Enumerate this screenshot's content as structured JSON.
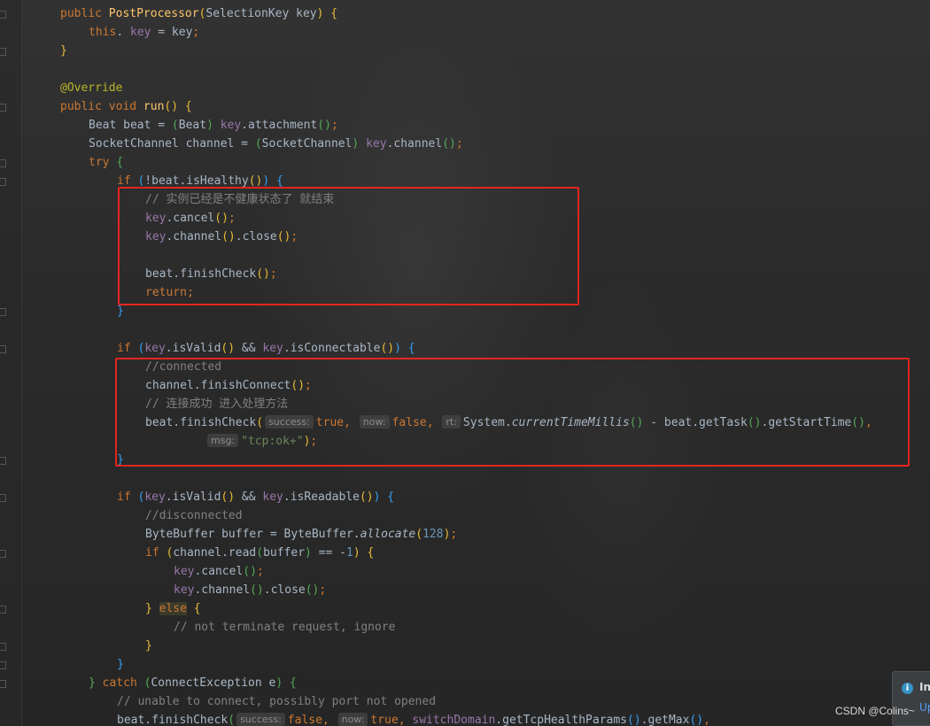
{
  "editor": {
    "lines": [
      [
        [
          "kw",
          "public "
        ],
        [
          "fn",
          "PostProcessor"
        ],
        [
          "b1",
          "("
        ],
        [
          "",
          "SelectionKey key"
        ],
        [
          "b1",
          ")"
        ],
        [
          "",
          " "
        ],
        [
          "b1",
          "{"
        ]
      ],
      [
        [
          "kw",
          "this"
        ],
        [
          "",
          ". "
        ],
        [
          "fld",
          "key"
        ],
        [
          "",
          " = key"
        ],
        [
          "kw",
          ";"
        ]
      ],
      [
        [
          "b1",
          "}"
        ]
      ],
      [],
      [
        [
          "an",
          "@Override"
        ]
      ],
      [
        [
          "kw",
          "public void "
        ],
        [
          "fn",
          "run"
        ],
        [
          "b1",
          "()"
        ],
        [
          "",
          " "
        ],
        [
          "b1",
          "{"
        ]
      ],
      [
        [
          "",
          "Beat beat = "
        ],
        [
          "b2",
          "("
        ],
        [
          "",
          "Beat"
        ],
        [
          "b2",
          ")"
        ],
        [
          "",
          " "
        ],
        [
          "fld",
          "key"
        ],
        [
          "",
          ".attachment"
        ],
        [
          "b2",
          "()"
        ],
        [
          "kw",
          ";"
        ]
      ],
      [
        [
          "",
          "SocketChannel channel = "
        ],
        [
          "b2",
          "("
        ],
        [
          "",
          "SocketChannel"
        ],
        [
          "b2",
          ")"
        ],
        [
          "",
          " "
        ],
        [
          "fld",
          "key"
        ],
        [
          "",
          ".channel"
        ],
        [
          "b2",
          "()"
        ],
        [
          "kw",
          ";"
        ]
      ],
      [
        [
          "kw",
          "try "
        ],
        [
          "b2",
          "{"
        ]
      ],
      [
        [
          "kw",
          "if "
        ],
        [
          "b3",
          "("
        ],
        [
          "",
          "!beat.isHealthy"
        ],
        [
          "b1",
          "()"
        ],
        [
          "b3",
          ")"
        ],
        [
          "",
          " "
        ],
        [
          "b3",
          "{"
        ]
      ],
      [
        [
          "cm",
          "// 实例已经是不健康状态了 就结束"
        ]
      ],
      [
        [
          "fld",
          "key"
        ],
        [
          "",
          ".cancel"
        ],
        [
          "b1",
          "()"
        ],
        [
          "kw",
          ";"
        ]
      ],
      [
        [
          "fld",
          "key"
        ],
        [
          "",
          ".channel"
        ],
        [
          "b1",
          "()"
        ],
        [
          "",
          ".close"
        ],
        [
          "b1",
          "()"
        ],
        [
          "kw",
          ";"
        ]
      ],
      [],
      [
        [
          "",
          "beat.finishCheck"
        ],
        [
          "b1",
          "()"
        ],
        [
          "kw",
          ";"
        ]
      ],
      [
        [
          "kw",
          "return;"
        ]
      ],
      [
        [
          "b3",
          "}"
        ]
      ],
      [],
      [
        [
          "kw",
          "if "
        ],
        [
          "b3",
          "("
        ],
        [
          "fld",
          "key"
        ],
        [
          "",
          ".isValid"
        ],
        [
          "b1",
          "()"
        ],
        [
          "",
          " && "
        ],
        [
          "fld",
          "key"
        ],
        [
          "",
          ".isConnectable"
        ],
        [
          "b1",
          "()"
        ],
        [
          "b3",
          ")"
        ],
        [
          "",
          " "
        ],
        [
          "b3",
          "{"
        ]
      ],
      [
        [
          "cm",
          "//connected"
        ]
      ],
      [
        [
          "",
          "channel.finishConnect"
        ],
        [
          "b1",
          "()"
        ],
        [
          "kw",
          ";"
        ]
      ],
      [
        [
          "cm",
          "// 连接成功 进入处理方法"
        ]
      ],
      [
        [
          "",
          "beat.finishCheck"
        ],
        [
          "b1",
          "("
        ],
        [
          "hint",
          "success:"
        ],
        [
          "kw",
          "true, "
        ],
        [
          "hint",
          "now:"
        ],
        [
          "kw",
          "false, "
        ],
        [
          "hint",
          "rt:"
        ],
        [
          "",
          "System."
        ],
        [
          "it",
          "currentTimeMillis"
        ],
        [
          "b2",
          "()"
        ],
        [
          "",
          " - beat.getTask"
        ],
        [
          "b2",
          "()"
        ],
        [
          "",
          ".getStartTime"
        ],
        [
          "b2",
          "()"
        ],
        [
          "kw",
          ","
        ]
      ],
      [
        [
          "hint",
          "msg:"
        ],
        [
          "str",
          "\"tcp:ok+\""
        ],
        [
          "b1",
          ")"
        ],
        [
          "kw",
          ";"
        ]
      ],
      [
        [
          "b3",
          "}"
        ]
      ],
      [],
      [
        [
          "kw",
          "if "
        ],
        [
          "b3",
          "("
        ],
        [
          "fld",
          "key"
        ],
        [
          "",
          ".isValid"
        ],
        [
          "b1",
          "()"
        ],
        [
          "",
          " && "
        ],
        [
          "fld",
          "key"
        ],
        [
          "",
          ".isReadable"
        ],
        [
          "b1",
          "()"
        ],
        [
          "b3",
          ")"
        ],
        [
          "",
          " "
        ],
        [
          "b3",
          "{"
        ]
      ],
      [
        [
          "cm",
          "//disconnected"
        ]
      ],
      [
        [
          "",
          "ByteBuffer buffer = ByteBuffer."
        ],
        [
          "it",
          "allocate"
        ],
        [
          "b1",
          "("
        ],
        [
          "num",
          "128"
        ],
        [
          "b1",
          ")"
        ],
        [
          "kw",
          ";"
        ]
      ],
      [
        [
          "kw",
          "if "
        ],
        [
          "b1",
          "("
        ],
        [
          "",
          "channel.read"
        ],
        [
          "b2",
          "("
        ],
        [
          "",
          "buffer"
        ],
        [
          "b2",
          ")"
        ],
        [
          "",
          " == -"
        ],
        [
          "num",
          "1"
        ],
        [
          "b1",
          ")"
        ],
        [
          "",
          " "
        ],
        [
          "b1",
          "{"
        ]
      ],
      [
        [
          "fld",
          "key"
        ],
        [
          "",
          ".cancel"
        ],
        [
          "b2",
          "()"
        ],
        [
          "kw",
          ";"
        ]
      ],
      [
        [
          "fld",
          "key"
        ],
        [
          "",
          ".channel"
        ],
        [
          "b2",
          "()"
        ],
        [
          "",
          ".close"
        ],
        [
          "b2",
          "()"
        ],
        [
          "kw",
          ";"
        ]
      ],
      [
        [
          "b1",
          "}"
        ],
        [
          "",
          " "
        ],
        [
          "else",
          "else"
        ],
        [
          "",
          " "
        ],
        [
          "b1",
          "{"
        ]
      ],
      [
        [
          "cm",
          "// not terminate request, ignore"
        ]
      ],
      [
        [
          "b1",
          "}"
        ]
      ],
      [
        [
          "b3",
          "}"
        ]
      ],
      [
        [
          "b2",
          "}"
        ],
        [
          "",
          " "
        ],
        [
          "kw",
          "catch "
        ],
        [
          "b2",
          "("
        ],
        [
          "",
          "ConnectException e"
        ],
        [
          "b2",
          ")"
        ],
        [
          "",
          " "
        ],
        [
          "b2",
          "{"
        ]
      ],
      [
        [
          "cm",
          "// unable to connect, possibly port not opened"
        ]
      ],
      [
        [
          "",
          "beat.finishCheck"
        ],
        [
          "b2",
          "("
        ],
        [
          "hint",
          "success:"
        ],
        [
          "kw",
          "false, "
        ],
        [
          "hint",
          "now:"
        ],
        [
          "kw",
          "true, "
        ],
        [
          "fld",
          "switchDomain"
        ],
        [
          "",
          ".getTcpHealthParams"
        ],
        [
          "b3",
          "()"
        ],
        [
          "",
          ".getMax"
        ],
        [
          "b3",
          "()"
        ],
        [
          "kw",
          ","
        ]
      ]
    ]
  },
  "notification": {
    "icon": "info-icon",
    "icon_glyph": "i",
    "title": "In",
    "link": "Up"
  },
  "watermark": "CSDN @Colins~"
}
